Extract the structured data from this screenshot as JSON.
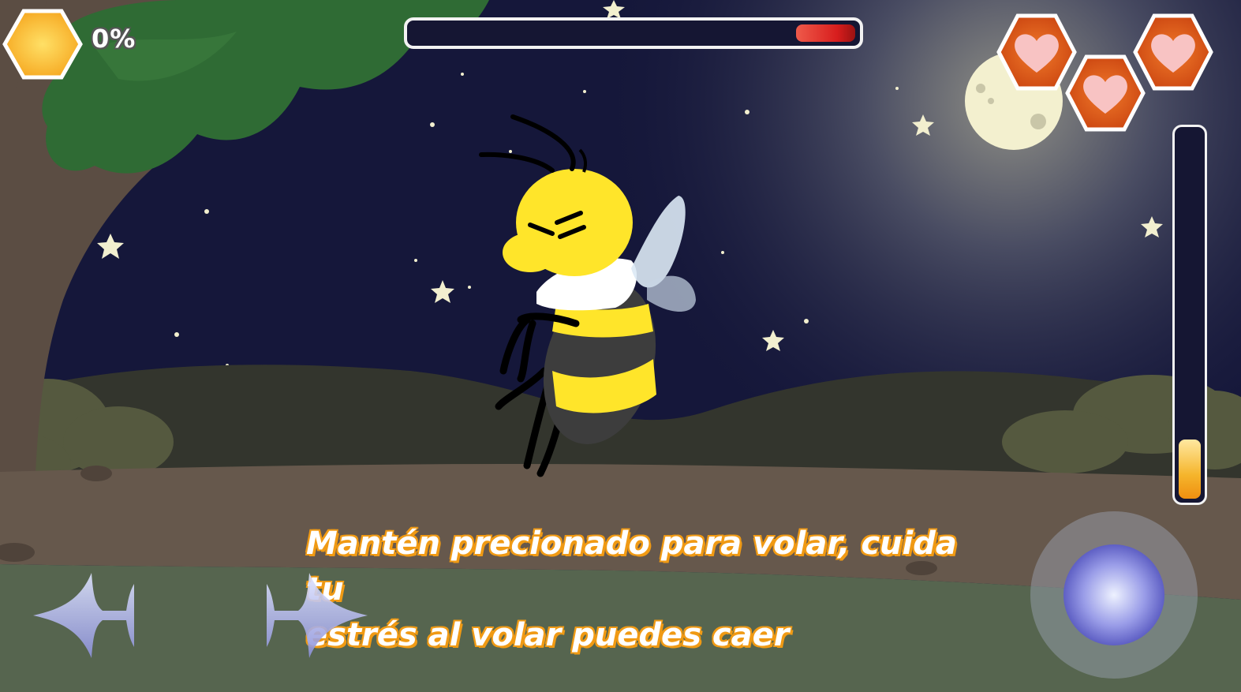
{
  "hud": {
    "honey_percent_text": "0%",
    "honey_icon": "honeycomb-hexagon-icon",
    "flight_progress": 0.13,
    "stress_level": 0.16,
    "lives": [
      {
        "icon": "heart-hex-icon",
        "filled": true
      },
      {
        "icon": "heart-hex-icon",
        "filled": true
      },
      {
        "icon": "heart-hex-icon",
        "filled": true
      }
    ]
  },
  "tutorial": {
    "line1": "Mantén precionado para volar, cuida tu",
    "line2": "estrés al volar puedes caer"
  },
  "controls": {
    "left_icon": "arrow-left-icon",
    "right_icon": "arrow-right-icon",
    "fly_icon": "fly-joystick-icon"
  },
  "colors": {
    "sky": "#15173a",
    "honey": "#f5b52c",
    "progress_fill": "#d71d1d",
    "text_outline": "#f09a14",
    "heart_hex": "#e9691c"
  }
}
